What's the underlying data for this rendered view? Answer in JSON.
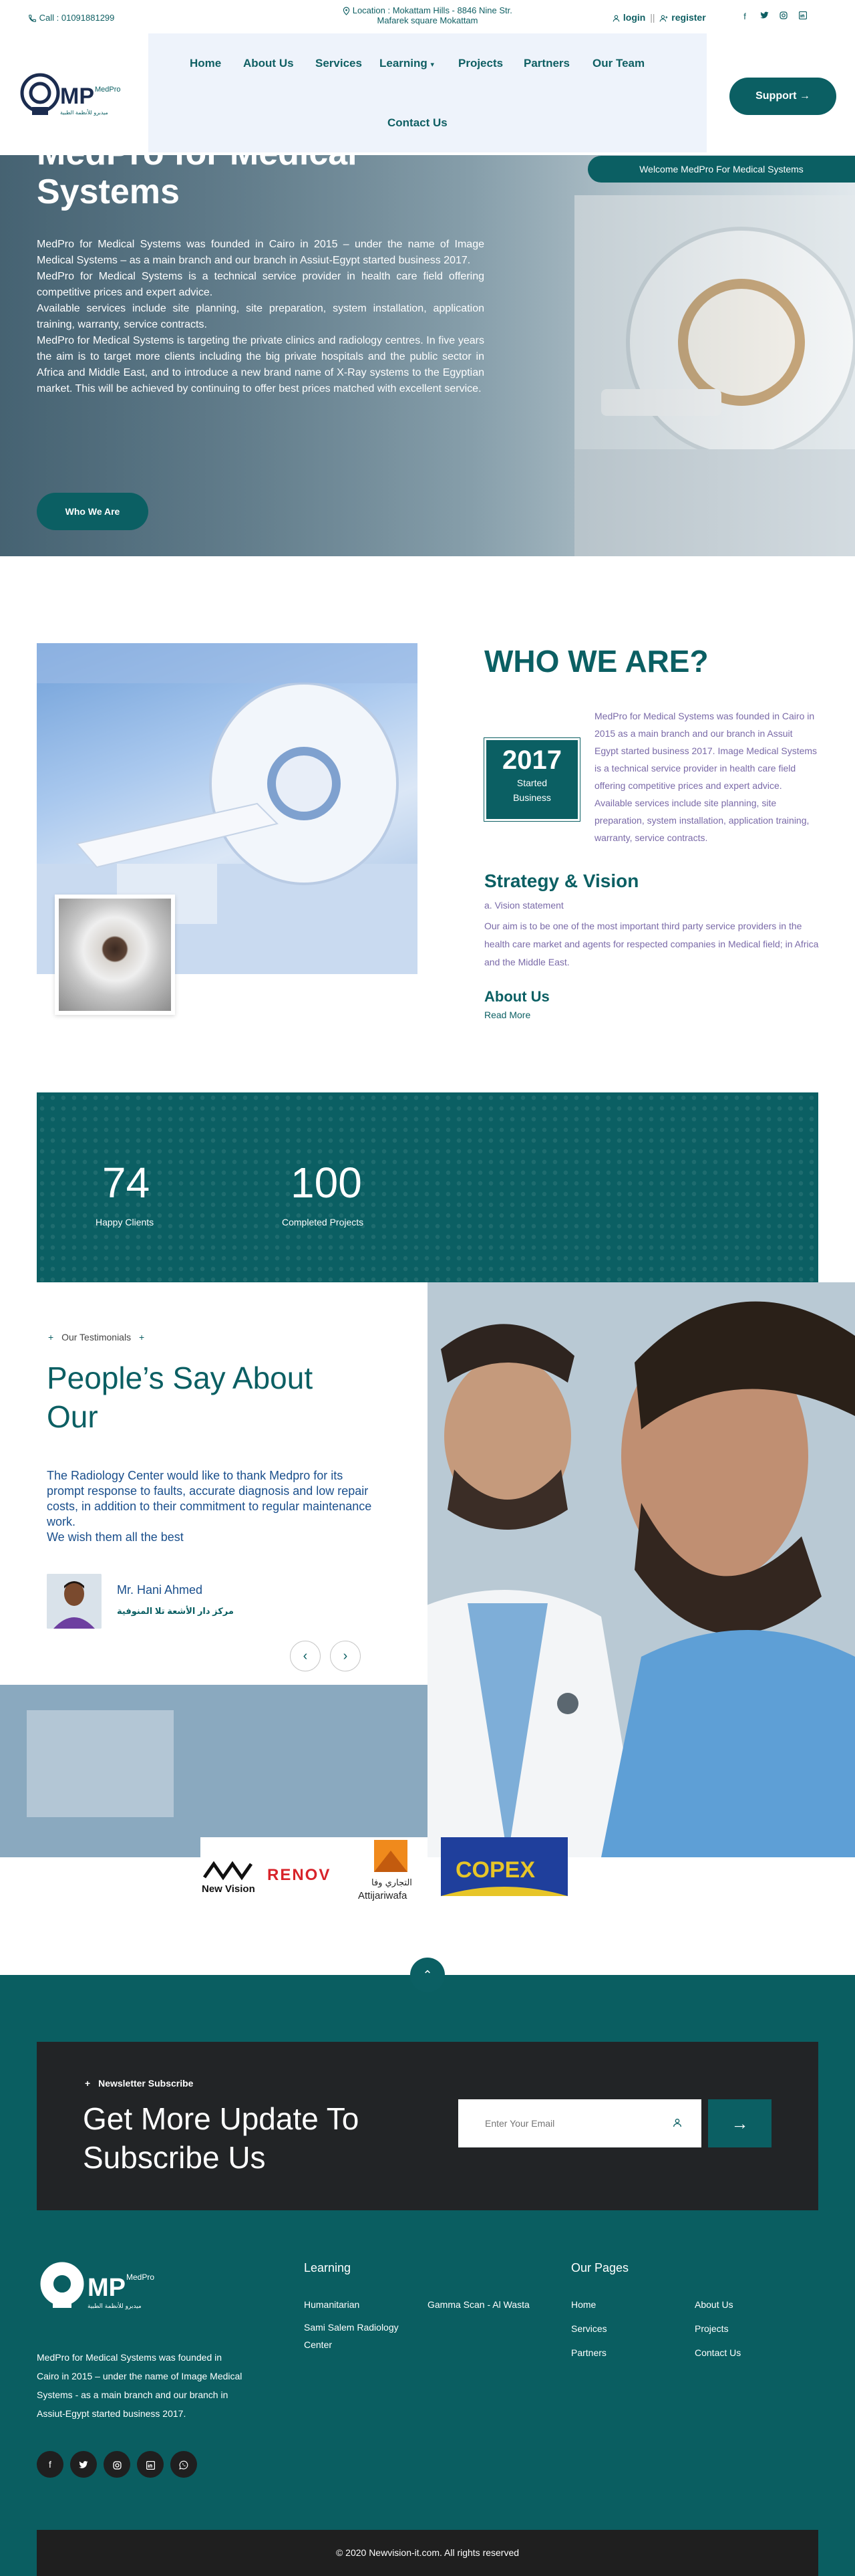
{
  "topbar": {
    "call": "Call : 01091881299",
    "location_line1": "Location : Mokattam Hills - 8846 Nine Str.",
    "location_line2": "Mafarek square Mokattam",
    "login": "login",
    "separator": "||",
    "register": "register",
    "social_icons": [
      "facebook-icon",
      "twitter-icon",
      "instagram-icon",
      "linkedin-icon",
      "whatsapp-icon"
    ]
  },
  "logo": {
    "mark": "MP",
    "name": "MedPro",
    "tagline": "ميدبرو للأنظمة الطبية"
  },
  "nav": {
    "items": [
      "Home",
      "About Us",
      "Services",
      "Learning",
      "Projects",
      "Partners",
      "Our Team",
      "Contact Us"
    ],
    "learning_caret": "▾"
  },
  "support": {
    "label": "Support",
    "arrow": "→"
  },
  "hero": {
    "title": "MedPro for Medical Systems",
    "paragraphs": [
      "MedPro for Medical Systems was founded in Cairo in 2015 – under the name of Image Medical Systems – as a main branch and our branch in Assiut-Egypt started business 2017.",
      "MedPro for Medical Systems is a technical service provider in health care field offering competitive prices and expert advice.",
      "Available services include site planning, site preparation, system installation, application training, warranty, service contracts.",
      "MedPro for Medical Systems is targeting the private clinics and radiology centres. In five years the aim is to target more clients including the big private hospitals and the public sector in Africa and Middle East, and to introduce a new brand name of X-Ray systems to the Egyptian market. This will be achieved by continuing to offer best prices matched with excellent service."
    ],
    "button": "Who We Are",
    "welcome_tag": "Welcome MedPro For Medical Systems"
  },
  "who": {
    "title": "WHO WE ARE?",
    "year": "2017",
    "year_label_1": "Started",
    "year_label_2": "Business",
    "text": "MedPro for Medical Systems was founded in Cairo in 2015 as a main branch and our branch in Assuit Egypt started business 2017. Image Medical Systems is a technical service provider in health care field offering competitive prices and expert advice. Available services include site planning, site preparation, system installation, application training, warranty, service contracts.",
    "strategy_title": "Strategy & Vision",
    "strategy_sub": "a. Vision statement",
    "strategy_text": "Our aim is to be one of the most important third party service providers in the health care market and agents for respected companies in Medical field; in Africa and the Middle East.",
    "about_title": "About Us",
    "read_more": "Read More"
  },
  "stats": [
    {
      "value": "74",
      "label": "Happy Clients"
    },
    {
      "value": "100",
      "label": "Completed Projects"
    }
  ],
  "testimonials": {
    "eyebrow": "Our Testimonials",
    "eyebrow_bullet": "+",
    "title": "People’s Say About Our",
    "quote_line1": "The Radiology Center would like to thank Medpro for its prompt response to faults, accurate diagnosis and low repair costs, in addition to their commitment to regular maintenance work.",
    "quote_line2": "We wish them all the best",
    "name": "Mr. Hani Ahmed",
    "role": "مركز دار الأشعة تلا المنوفية",
    "prev": "‹",
    "next": "›"
  },
  "partners": [
    "New Vision",
    "RENOV",
    "Attijariwafa",
    "COPEX"
  ],
  "partner_extra": {
    "attijari_arabic": "التجاري وفا"
  },
  "scroll_up": "⌃",
  "newsletter": {
    "eyebrow": "Newsletter Subscribe",
    "eyebrow_bullet": "+",
    "title": "Get More Update To Subscribe Us",
    "placeholder": "Enter Your Email",
    "submit_arrow": "→"
  },
  "footer": {
    "about": "MedPro for Medical Systems was founded in Cairo in 2015 – under the name of Image Medical Systems - as a main branch and our branch in Assiut-Egypt started business 2017.",
    "learning_title": "Learning",
    "learning_links": [
      "Humanitarian",
      "Gamma Scan - Al Wasta",
      "Sami Salem Radiology Center"
    ],
    "pages_title": "Our Pages",
    "pages_col1": [
      "Home",
      "Services",
      "Partners"
    ],
    "pages_col2": [
      "About Us",
      "Projects",
      "Contact Us"
    ],
    "social_icons": [
      "facebook-icon",
      "twitter-icon",
      "instagram-icon",
      "linkedin-icon",
      "whatsapp-icon"
    ],
    "copyright": "© 2020 Newvision-it.com. All rights reserved"
  },
  "colors": {
    "brand": "#0b5f63",
    "footer": "#0a5e61",
    "dark": "#222426",
    "text_purple": "#7a6aa8",
    "text_blue": "#1a4f8c"
  }
}
